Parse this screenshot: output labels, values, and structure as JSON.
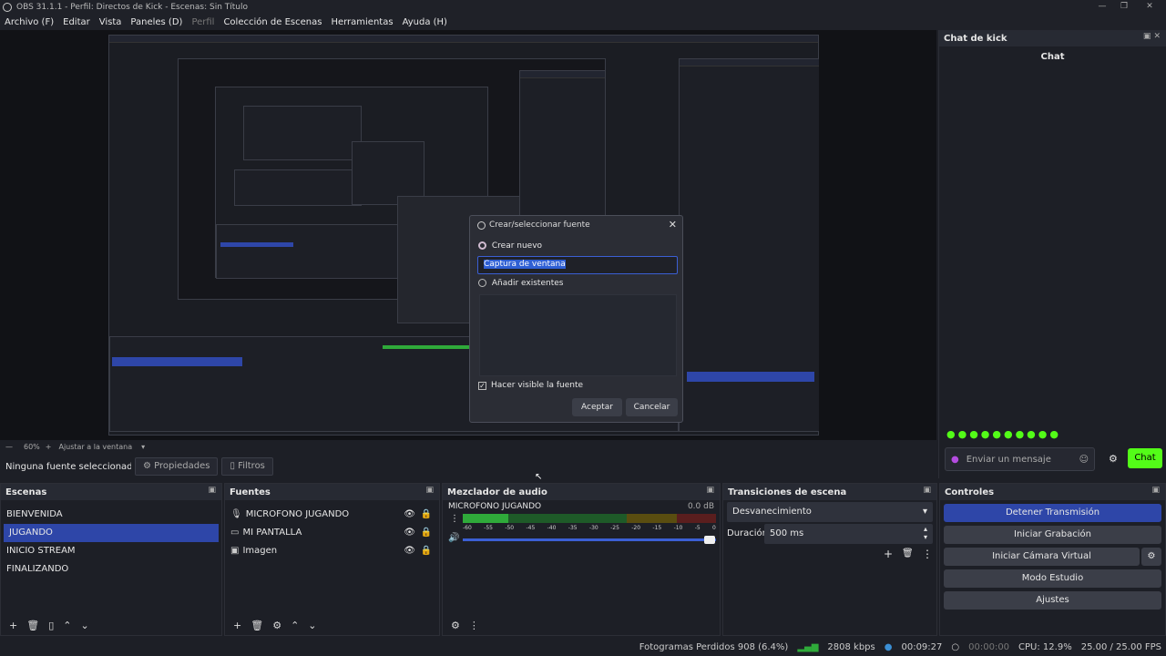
{
  "window": {
    "title": "OBS 31.1.1 - Perfil: Directos de Kick - Escenas: Sin Título",
    "minimize": "—",
    "maximize": "❐",
    "close": "✕"
  },
  "menu": {
    "archivo": "Archivo (F)",
    "editar": "Editar",
    "vista": "Vista",
    "paneles": "Paneles (D)",
    "perfil": "Perfil",
    "coleccion": "Colección de Escenas",
    "herramientas": "Herramientas",
    "ayuda": "Ayuda (H)"
  },
  "dialog": {
    "title": "Crear/seleccionar fuente",
    "create_new": "Crear nuevo",
    "input_value": "Captura de ventana",
    "add_existing": "Añadir existentes",
    "visible_label": "Hacer visible la fuente",
    "accept": "Aceptar",
    "cancel": "Cancelar"
  },
  "chat_dock": {
    "title": "Chat de kick",
    "header": "Chat",
    "placeholder": "Enviar un mensaje",
    "chat_button": "Chat",
    "accent": "#53fc18"
  },
  "zoom": {
    "level": "60%",
    "fit": "Ajustar a la ventana"
  },
  "props": {
    "no_source": "Ninguna fuente seleccionada",
    "properties": "Propiedades",
    "filters": "Filtros"
  },
  "scenes": {
    "title": "Escenas",
    "items": [
      {
        "label": "BIENVENIDA"
      },
      {
        "label": "JUGANDO"
      },
      {
        "label": "INICIO STREAM"
      },
      {
        "label": "FINALIZANDO"
      }
    ]
  },
  "sources": {
    "title": "Fuentes",
    "items": [
      {
        "label": "MICROFONO JUGANDO",
        "icon": "microphone-icon"
      },
      {
        "label": "MI PANTALLA",
        "icon": "monitor-icon"
      },
      {
        "label": "Imagen",
        "icon": "image-icon"
      }
    ]
  },
  "mixer": {
    "title": "Mezclador de audio",
    "channel": "MICROFONO JUGANDO",
    "db": "0.0 dB",
    "ticks": [
      "-60",
      "-55",
      "-50",
      "-45",
      "-40",
      "-35",
      "-30",
      "-25",
      "-20",
      "-15",
      "-10",
      "-5",
      "0"
    ]
  },
  "transitions": {
    "title": "Transiciones de escena",
    "selected": "Desvanecimiento",
    "duration_label": "Duración",
    "duration_value": "500 ms"
  },
  "controls": {
    "title": "Controles",
    "stop_stream": "Detener Transmisión",
    "start_recording": "Iniciar Grabación",
    "start_virtual_cam": "Iniciar Cámara Virtual",
    "studio_mode": "Modo Estudio",
    "settings": "Ajustes"
  },
  "status": {
    "dropped": "Fotogramas Perdidos 908 (6.4%)",
    "bitrate": "2808 kbps",
    "stream_time": "00:09:27",
    "rec_time": "00:00:00",
    "cpu": "CPU: 12.9%",
    "fps": "25.00 / 25.00 FPS"
  }
}
